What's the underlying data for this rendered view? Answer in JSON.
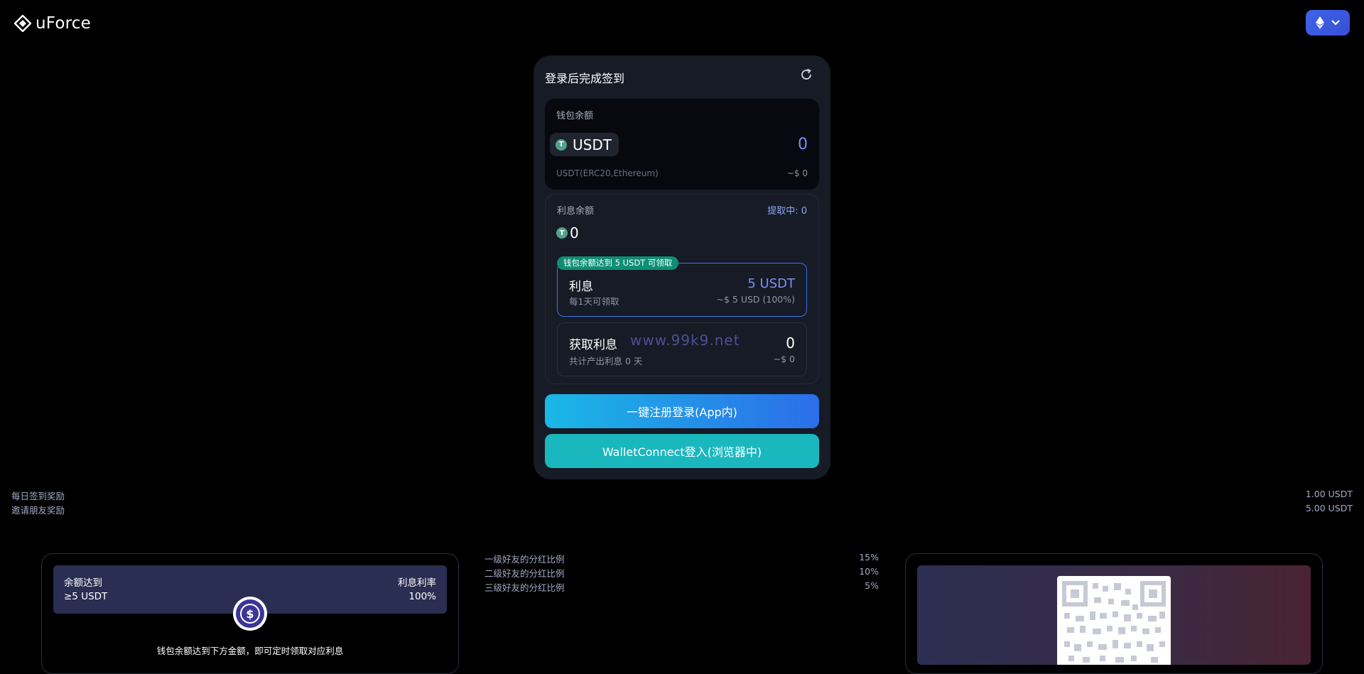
{
  "header": {
    "brand": "uForce"
  },
  "card": {
    "title": "登录后完成签到",
    "wallet": {
      "label": "钱包余额",
      "token": "USDT",
      "amount": "0",
      "chain": "USDT(ERC20,Ethereum)",
      "usd": "~$ 0"
    },
    "interest": {
      "label": "利息余额",
      "withdrawing": "提取中: 0",
      "amount": "0",
      "plan_badge": "钱包余额达到 5 USDT 可领取",
      "plan_title": "利息",
      "plan_sub": "每1天可领取",
      "plan_value": "5 USDT",
      "plan_usd": "~$ 5 USD (100%)",
      "earn_title": "获取利息",
      "watermark": "www.99k9.net",
      "earn_sub": "共计产出利息 0 天",
      "earn_value": "0",
      "earn_usd": "~$ 0"
    },
    "register_button": "一键注册登录(App内)",
    "walletconnect_button": "WalletConnect登入(浏览器中)"
  },
  "rewards": [
    {
      "label": "每日签到奖励",
      "value": "1.00 USDT"
    },
    {
      "label": "邀请朋友奖励",
      "value": "5.00 USDT"
    }
  ],
  "rate_panel": {
    "left_head": "余额达到",
    "left_value": "≥5 USDT",
    "right_head": "利息利率",
    "right_value": "100%",
    "note": "钱包余额达到下方金额，即可定时领取对应利息"
  },
  "referrals": [
    {
      "label": "一级好友的分红比例",
      "value": "15%"
    },
    {
      "label": "二级好友的分红比例",
      "value": "10%"
    },
    {
      "label": "三级好友的分红比例",
      "value": "5%"
    }
  ],
  "colors": {
    "accent": "#7d8ef7",
    "teal": "#1bb7bf",
    "card": "#161b25"
  },
  "icons": [
    "uforce-logo-icon",
    "ethereum-icon",
    "chevron-down-icon",
    "refresh-icon",
    "tether-icon",
    "dollar-exchange-icon",
    "qr-code"
  ]
}
